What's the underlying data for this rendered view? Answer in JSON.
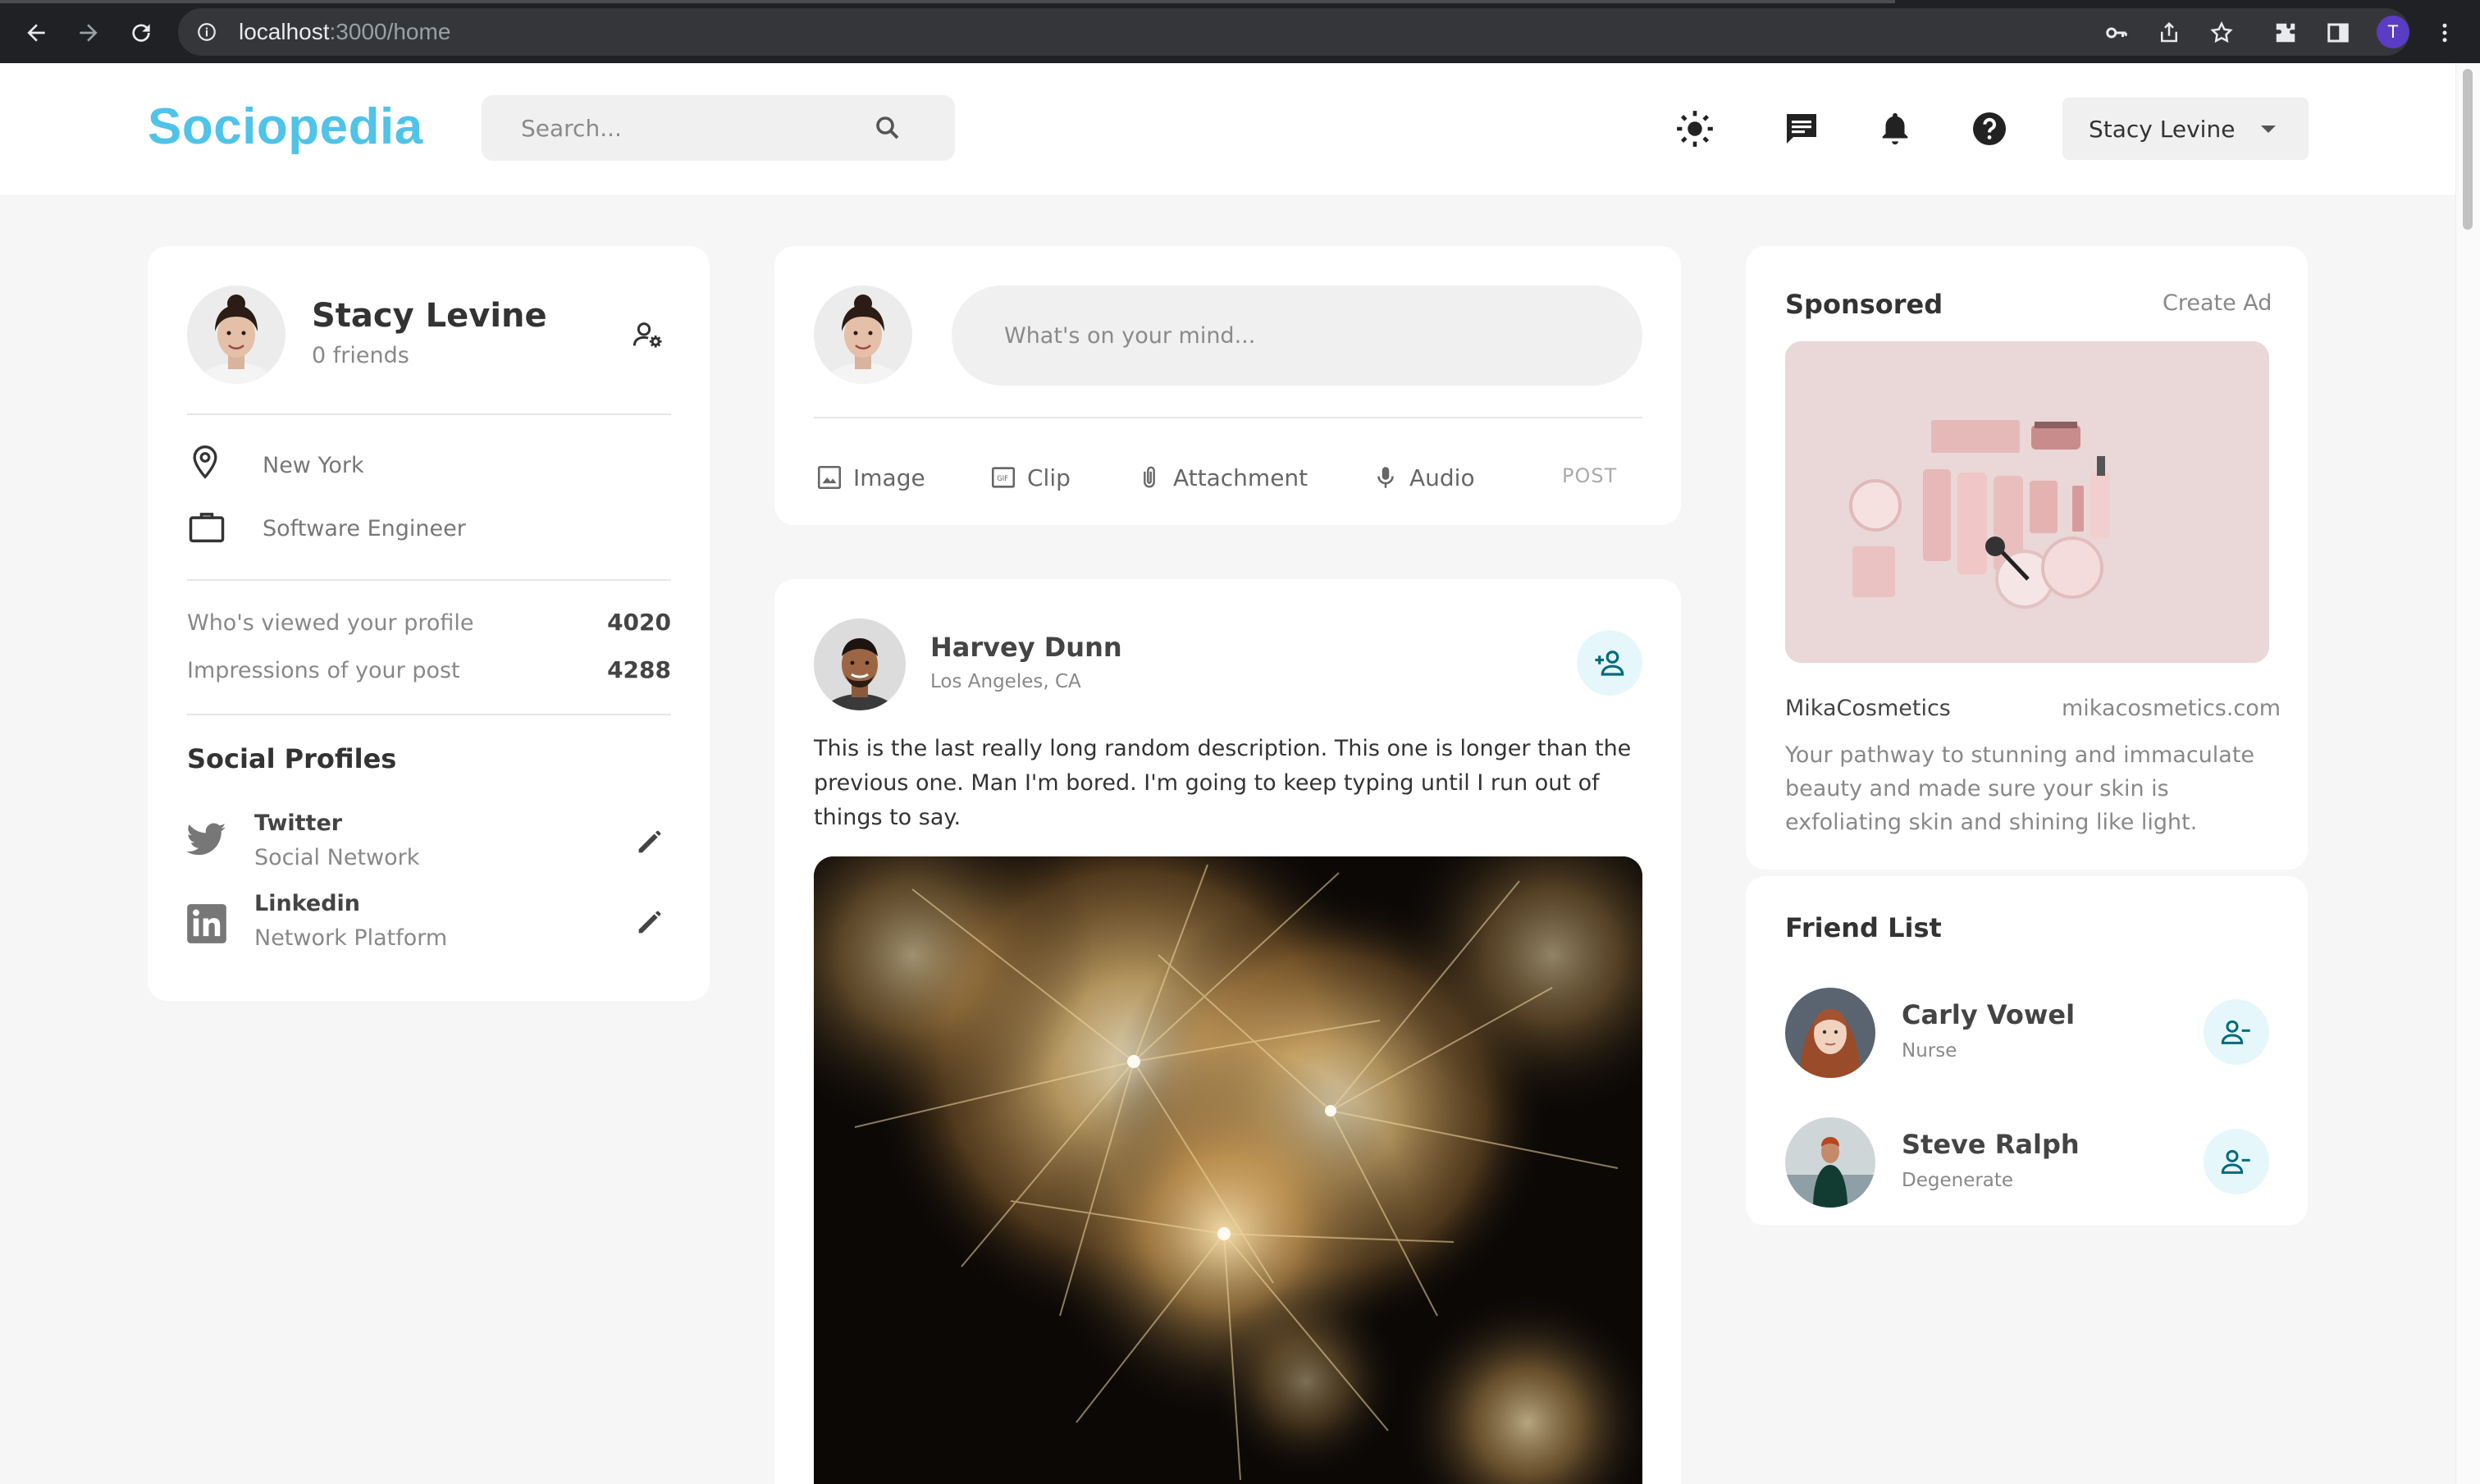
{
  "browser": {
    "url_host": "localhost",
    "url_path": ":3000/home",
    "profile_initial": "T"
  },
  "navbar": {
    "logo": "Sociopedia",
    "search_placeholder": "Search...",
    "user_name": "Stacy Levine"
  },
  "profile": {
    "name": "Stacy Levine",
    "friends": "0 friends",
    "location": "New York",
    "occupation": "Software Engineer",
    "stats": [
      {
        "label": "Who's viewed your profile",
        "value": "4020"
      },
      {
        "label": "Impressions of your post",
        "value": "4288"
      }
    ],
    "social_title": "Social Profiles",
    "socials": [
      {
        "name": "Twitter",
        "sub": "Social Network"
      },
      {
        "name": "Linkedin",
        "sub": "Network Platform"
      }
    ]
  },
  "composer": {
    "placeholder": "What's on your mind...",
    "actions": [
      "Image",
      "Clip",
      "Attachment",
      "Audio"
    ],
    "post_label": "POST"
  },
  "post": {
    "author": "Harvey Dunn",
    "location": "Los Angeles, CA",
    "description": "This is the last really long random description. This one is longer than the previous one. Man I'm bored. I'm going to keep typing until I run out of things to say."
  },
  "sponsored": {
    "title": "Sponsored",
    "create_ad": "Create Ad",
    "brand": "MikaCosmetics",
    "url": "mikacosmetics.com",
    "text": "Your pathway to stunning and immaculate beauty and made sure your skin is exfoliating skin and shining like light."
  },
  "friend_list": {
    "title": "Friend List",
    "friends": [
      {
        "name": "Carly Vowel",
        "sub": "Nurse"
      },
      {
        "name": "Steve Ralph",
        "sub": "Degenerate"
      }
    ]
  },
  "colors": {
    "brand": "#4fc3e8",
    "background": "#f6f6f6",
    "card": "#ffffff",
    "accent_light": "#e6f7fb",
    "accent_icon": "#006b7d"
  }
}
